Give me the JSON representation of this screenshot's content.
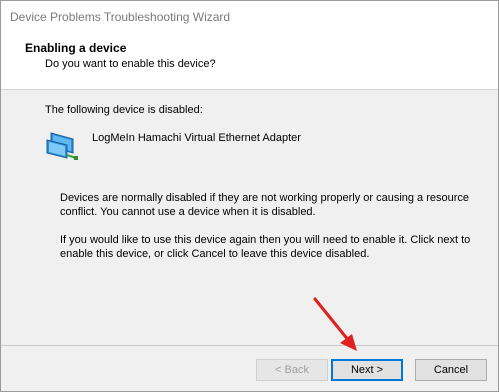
{
  "window": {
    "title": "Device Problems Troubleshooting Wizard"
  },
  "header": {
    "title": "Enabling a device",
    "subtitle": "Do you want to enable this device?"
  },
  "content": {
    "intro": "The following device is disabled:",
    "device_name": "LogMeIn Hamachi Virtual Ethernet Adapter",
    "device_icon": "network-adapter-icon",
    "paragraph1": "Devices are normally disabled if they are not working properly or causing a resource conflict. You cannot use a device when it is disabled.",
    "paragraph2": "If you would like to use this device again then you will need to enable it. Click next to enable this device, or click Cancel to leave this device disabled."
  },
  "buttons": {
    "back": "< Back",
    "next": "Next >",
    "cancel": "Cancel"
  },
  "colors": {
    "accent": "#0078d7",
    "annotation_arrow": "#e02020"
  }
}
